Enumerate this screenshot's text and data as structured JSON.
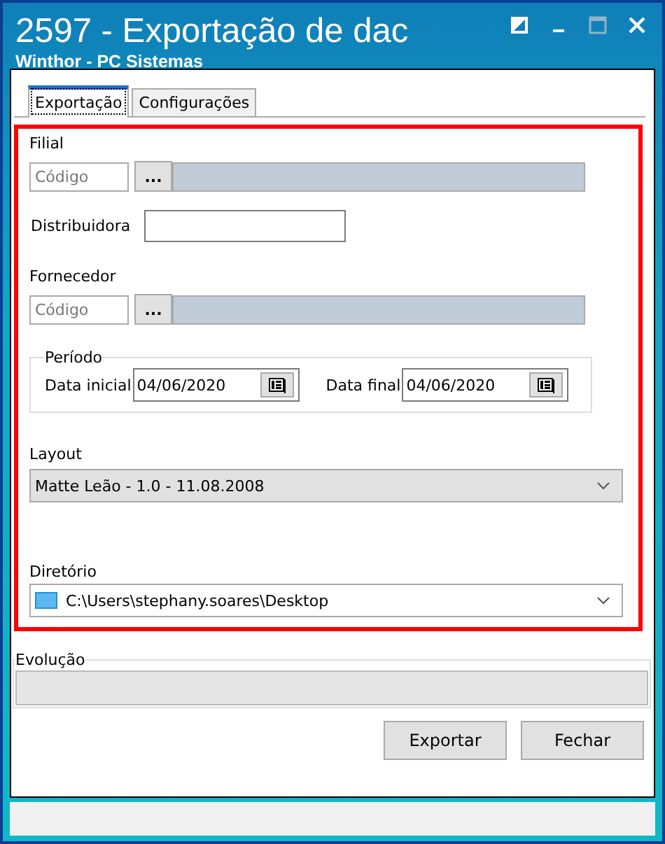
{
  "window": {
    "title": "2597 - Exportação de dac",
    "subtitle": "Winthor - PC Sistemas"
  },
  "tabs": [
    {
      "label": "Exportação",
      "selected": true
    },
    {
      "label": "Configurações",
      "selected": false
    }
  ],
  "filial": {
    "label": "Filial",
    "placeholder": "Código",
    "button": "..."
  },
  "distribuidora": {
    "label": "Distribuidora"
  },
  "fornecedor": {
    "label": "Fornecedor",
    "placeholder": "Código",
    "button": "..."
  },
  "periodo": {
    "label": "Período",
    "start_label": "Data inicial",
    "start": "04/06/2020",
    "end_label": "Data final",
    "end": "04/06/2020"
  },
  "layout": {
    "label": "Layout",
    "value": "Matte Leão - 1.0 - 11.08.2008"
  },
  "diretorio": {
    "label": "Diretório",
    "value": "C:\\Users\\stephany.soares\\Desktop"
  },
  "evolucao": {
    "label": "Evolução",
    "level": 0
  },
  "buttons": [
    "Exportar",
    "Fechar"
  ]
}
